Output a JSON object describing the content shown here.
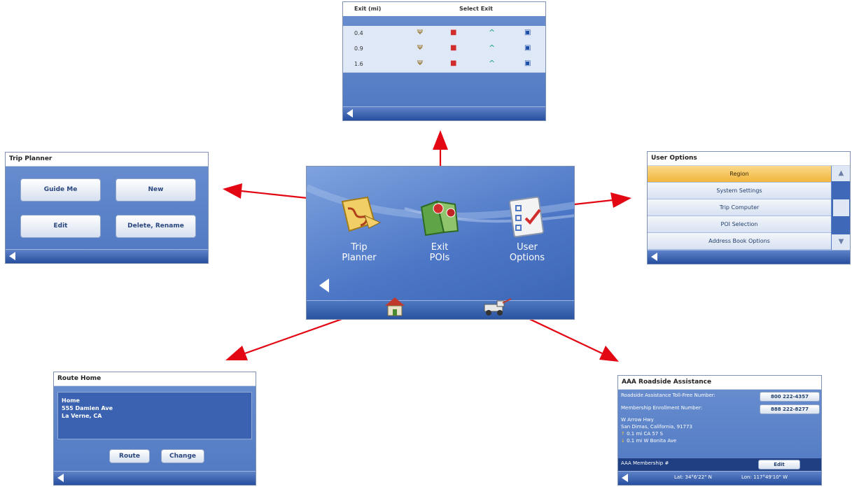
{
  "main_menu": {
    "trip_planner_label_1": "Trip",
    "trip_planner_label_2": "Planner",
    "exit_pois_label_1": "Exit",
    "exit_pois_label_2": "POIs",
    "user_options_label_1": "User",
    "user_options_label_2": "Options"
  },
  "exit_screen": {
    "col_exit": "Exit",
    "col_unit": "(mi)",
    "col_select": "Select Exit",
    "rows": [
      "0.4",
      "0.9",
      "1.6"
    ]
  },
  "trip_planner": {
    "title": "Trip Planner",
    "buttons": [
      "Guide Me",
      "New",
      "Edit",
      "Delete, Rename"
    ]
  },
  "user_options": {
    "title": "User Options",
    "items": [
      "Region",
      "System Settings",
      "Trip Computer",
      "POI Selection",
      "Address Book Options"
    ]
  },
  "route_home": {
    "title": "Route Home",
    "address_line_1": "Home",
    "address_line_2": "555 Damien Ave",
    "address_line_3": "La Verne, CA",
    "route_label": "Route",
    "change_label": "Change"
  },
  "aaa": {
    "title": "AAA Roadside Assistance",
    "tollfree_label": "Roadside Assistance Toll-Free Number:",
    "tollfree_number": "800 222-4357",
    "enroll_label": "Membership Enrollment Number:",
    "enroll_number": "888 222-8277",
    "location_1": "W Arrow Hwy",
    "location_2": "San Dimas, California, 91773",
    "location_3": "0.1 mi CA 57 S",
    "location_4": "0.1 mi W Bonita Ave",
    "membership_label": "AAA Membership #",
    "edit_label": "Edit",
    "lat": "Lat: 34°6'22\" N",
    "lon": "Lon: 117°49'10\" W"
  },
  "colors": {
    "arrow": "#e30613",
    "screen_blue": "#4f78c2",
    "highlight": "#f6c24a"
  }
}
